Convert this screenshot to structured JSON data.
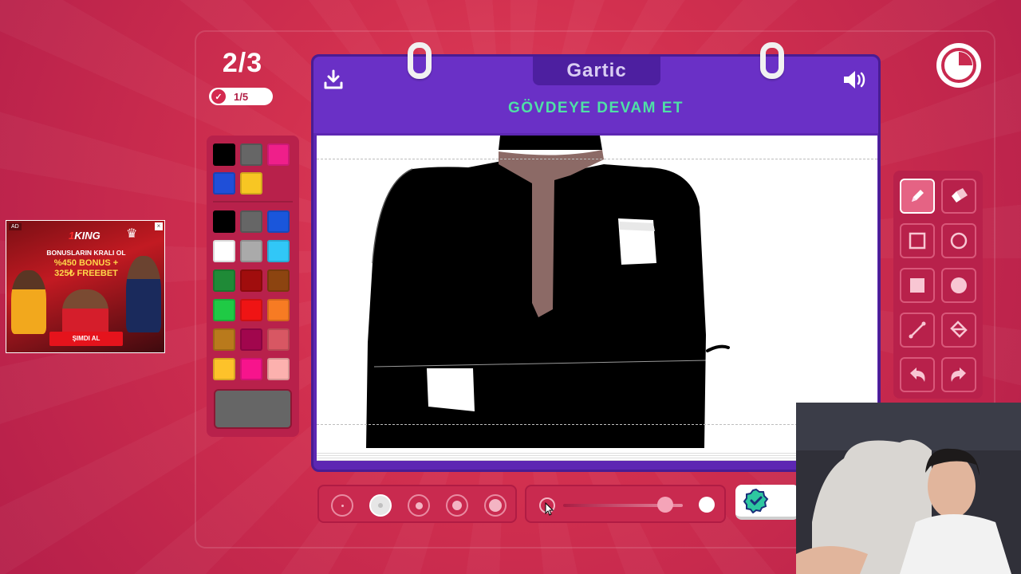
{
  "round": {
    "label": "2/3"
  },
  "progress": {
    "label": "1/5"
  },
  "header": {
    "logo": "Gartic",
    "title": "GÖVDEYE DEVAM ET"
  },
  "palette": {
    "colors_top": [
      "#000000",
      "#666666",
      "#ef1f8a",
      "#1f4fd8",
      "#f7c623"
    ],
    "colors_main": [
      "#000000",
      "#666666",
      "#1a56db",
      "#ffffff",
      "#aaaaaa",
      "#31c7f7",
      "#1f8a37",
      "#a00d0d",
      "#8c4410",
      "#1fca45",
      "#ef1414",
      "#f77b23",
      "#b97a1c",
      "#a1064d",
      "#d85763",
      "#fdc22a",
      "#f7148c",
      "#fcb1ae"
    ],
    "current_color": "#666666"
  },
  "ad": {
    "tag": "AD",
    "brand_prefix": "1",
    "brand": "KING",
    "headline": "BONUSLARIN KRALI OL",
    "bonus_line1": "%450 BONUS +",
    "bonus_line2": "325₺ FREEBET",
    "cta": "ŞIMDI AL"
  },
  "tools": {
    "items": [
      "pencil-icon",
      "eraser-icon",
      "square-outline-icon",
      "circle-outline-icon",
      "square-fill-icon",
      "circle-fill-icon",
      "line-icon",
      "fill-bucket-icon",
      "undo-icon",
      "redo-icon"
    ],
    "active": "pencil-icon"
  },
  "brush_sizes": {
    "count": 5,
    "active_index": 1
  },
  "opacity": {
    "value": 0.85
  },
  "colors": {
    "accent": "#4fe0a6",
    "notebook": "#5d27b3",
    "background": "#d2304f"
  }
}
